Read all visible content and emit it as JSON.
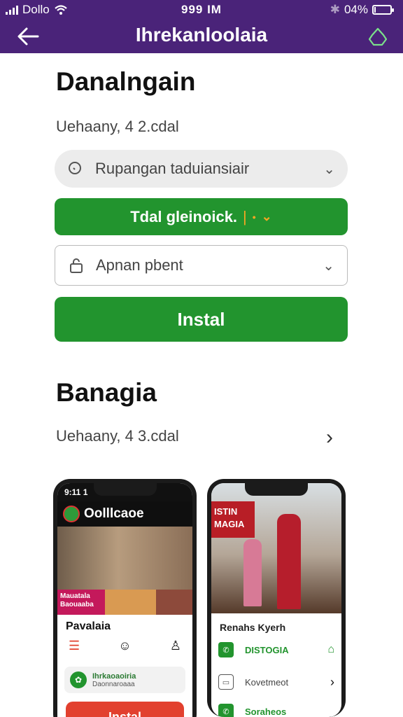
{
  "status_bar": {
    "carrier": "Dollo",
    "time": "999 IM",
    "battery": "04%",
    "battery_level": 0.04
  },
  "app_bar": {
    "title": "Ihrekanloolaia",
    "back_icon": "back-arrow-icon",
    "action_icon": "basket-icon"
  },
  "section1": {
    "title": "Danalngain",
    "subtitle": "Uehaany, 4 2.cdal",
    "search": {
      "value": "Rupangan taduiansiair",
      "icon": "search-icon"
    },
    "primary_button": {
      "label": "Tdal gleinoick.",
      "separator": "|"
    },
    "picker": {
      "value": "Apnan pbent",
      "icon": "lock-icon"
    },
    "install_button": {
      "label": "Instal"
    }
  },
  "section2": {
    "title": "Banagia",
    "subtitle": "Uehaany, 4 3.cdal"
  },
  "screenshot1": {
    "status_time": "9:11 1",
    "header_title": "Oolllcaoe",
    "tile_label": "Mauatala Baouaaba",
    "name": "Pavalaia",
    "card_title": "Ihrkaoaoiria",
    "card_subtitle": "Daonnaroaaa",
    "button_label": "Instal"
  },
  "screenshot2": {
    "sign_text": "ISTIN MAGIA",
    "name": "Renahs Kyerh",
    "row1": "DISTOGIA",
    "row2": "Kovetmeot",
    "row3": "Soraheos"
  },
  "colors": {
    "brand_purple": "#4a2379",
    "action_green": "#22942e",
    "accent_red": "#e2402e"
  }
}
